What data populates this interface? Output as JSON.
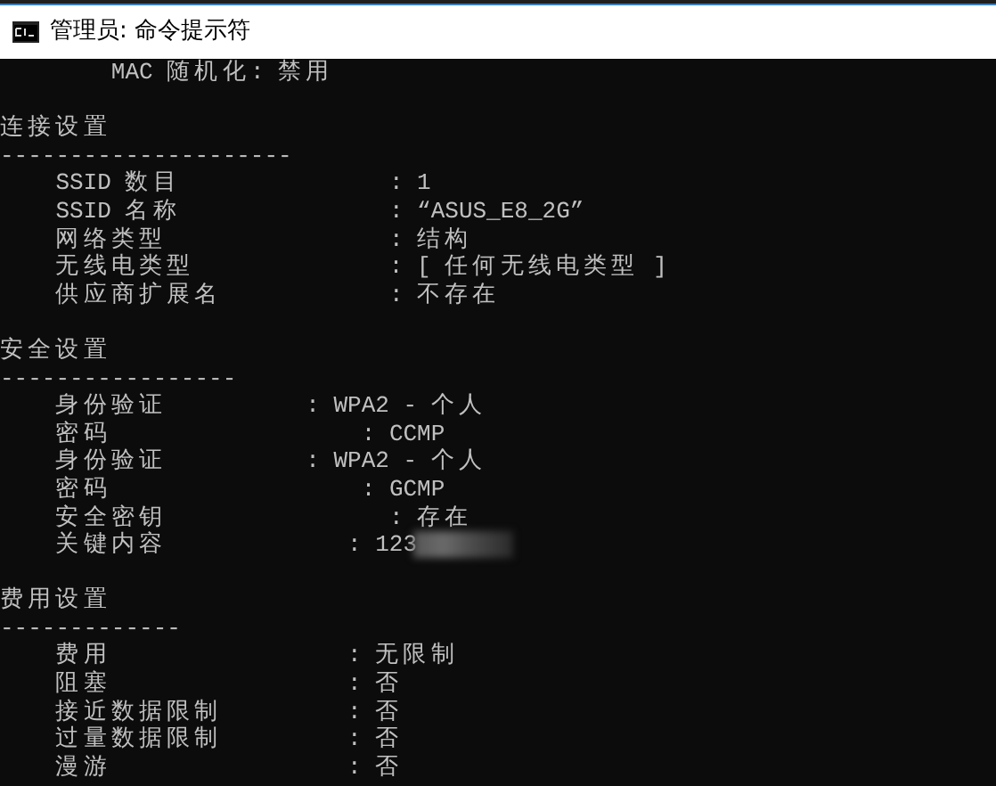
{
  "window": {
    "title": "管理员: 命令提示符"
  },
  "console": {
    "top_line": "MAC 随机化: 禁用",
    "sections": [
      {
        "heading": "连接设置",
        "rule": "---------------------",
        "rows": [
          {
            "label": "SSID 数目",
            "value": "               : 1"
          },
          {
            "label": "SSID 名称",
            "value": "               : “ASUS_E8_2G”"
          },
          {
            "label": "网络类型",
            "value": "                : 结构"
          },
          {
            "label": "无线电类型",
            "value": "              : [ 任何无线电类型 ]"
          },
          {
            "label": "供应商扩展名",
            "value": "            : 不存在"
          }
        ]
      },
      {
        "heading": "安全设置",
        "rule": "-----------------",
        "rows": [
          {
            "label": "身份验证",
            "value": "          : WPA2 - 个人"
          },
          {
            "label": "密码",
            "value": "                  : CCMP"
          },
          {
            "label": "身份验证",
            "value": "          : WPA2 - 个人"
          },
          {
            "label": "密码",
            "value": "                  : GCMP"
          },
          {
            "label": "安全密钥",
            "value": "                : 存在"
          },
          {
            "label": "关键内容",
            "value": "             : 123",
            "blurred": true
          }
        ]
      },
      {
        "heading": "费用设置",
        "rule": "-------------",
        "rows": [
          {
            "label": "费用",
            "value": "                 : 无限制"
          },
          {
            "label": "阻塞",
            "value": "                 : 否"
          },
          {
            "label": "接近数据限制",
            "value": "         : 否"
          },
          {
            "label": "过量数据限制",
            "value": "         : 否"
          },
          {
            "label": "漫游",
            "value": "                 : 否"
          }
        ]
      }
    ]
  }
}
